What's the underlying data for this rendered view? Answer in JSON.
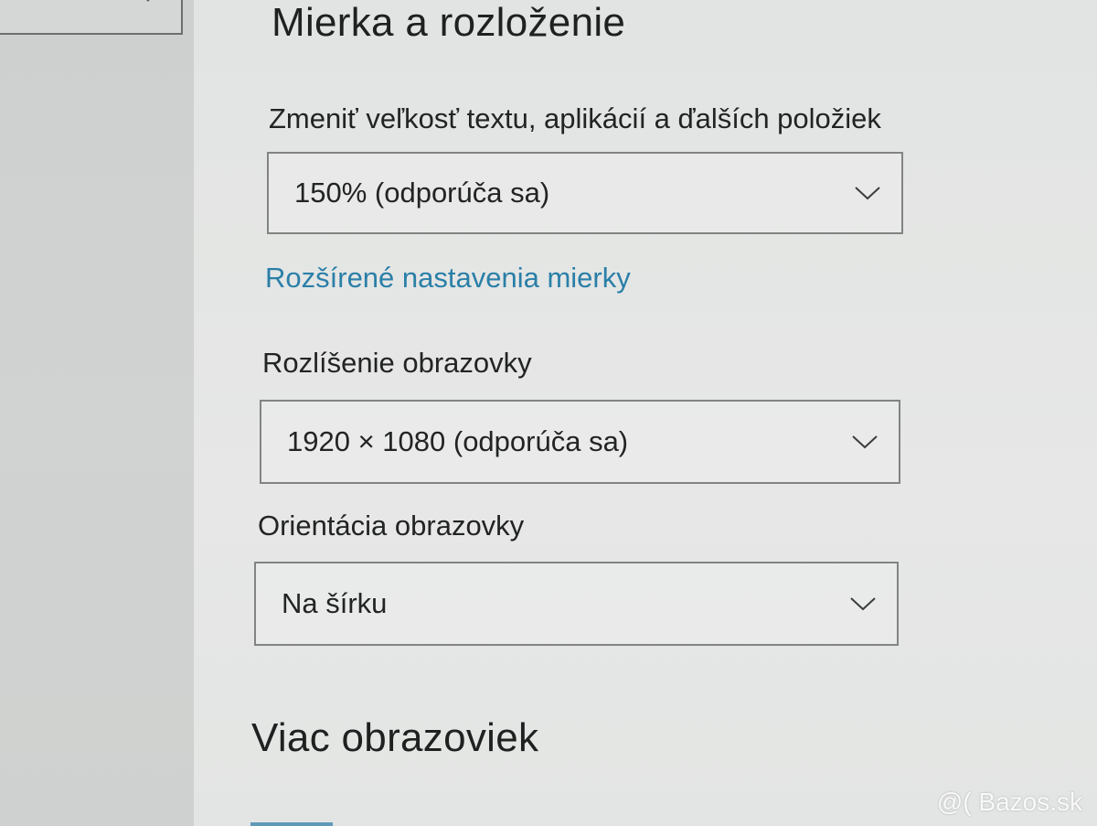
{
  "layout_section": {
    "heading": "Mierka a rozloženie",
    "scale_label": "Zmeniť veľkosť textu, aplikácií a ďalších položiek",
    "scale_value": "150% (odporúča sa)",
    "advanced_link": "Rozšírené nastavenia mierky",
    "resolution_label": "Rozlíšenie obrazovky",
    "resolution_value": "1920 × 1080 (odporúča sa)",
    "orientation_label": "Orientácia obrazovky",
    "orientation_value": "Na šírku"
  },
  "multi_display_section": {
    "heading": "Viac obrazoviek"
  },
  "watermark": "@( Bazos.sk",
  "icons": {
    "search": "search-icon",
    "dropdown": "chevron-down-icon"
  },
  "colors": {
    "link": "#2a7fa8",
    "text": "#222423",
    "border": "#828483",
    "background": "#e4e6e5"
  }
}
